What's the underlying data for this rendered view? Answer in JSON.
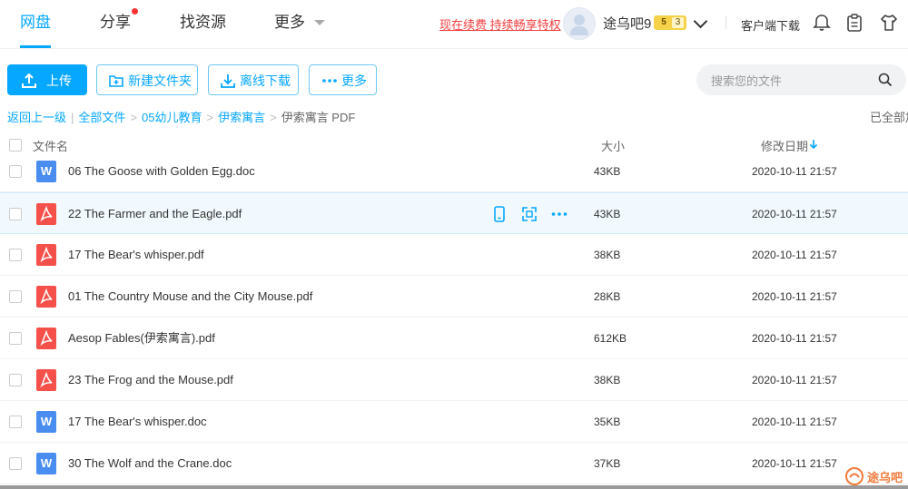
{
  "nav": {
    "tabs": [
      {
        "label": "网盘",
        "active": true
      },
      {
        "label": "分享"
      },
      {
        "label": "找资源"
      },
      {
        "label": "更多"
      }
    ],
    "promo": "现在续费 持续畅享特权",
    "username": "途乌吧9",
    "vip_level": "5",
    "vip_sub": "3",
    "client_download": "客户端下载",
    "icons": [
      "bell-icon",
      "clipboard-icon",
      "shirt-icon"
    ]
  },
  "toolbar": {
    "upload": "上传",
    "new_folder": "新建文件夹",
    "offline_download": "离线下载",
    "more": "更多"
  },
  "search": {
    "placeholder": "搜索您的文件"
  },
  "breadcrumb": {
    "back": "返回上一级",
    "items": [
      "全部文件",
      "05幼儿教育",
      "伊索寓言"
    ],
    "current": "伊索寓言 PDF"
  },
  "status": "已全部加",
  "table": {
    "headers": {
      "name": "文件名",
      "size": "大小",
      "date": "修改日期"
    },
    "rows": [
      {
        "name": "06 The Goose with Golden Egg.doc",
        "type": "doc",
        "size": "43KB",
        "date": "2020-10-11 21:57"
      },
      {
        "name": "22 The Farmer and the Eagle.pdf",
        "type": "pdf",
        "size": "43KB",
        "date": "2020-10-11 21:57",
        "hover": true
      },
      {
        "name": "17 The Bear's whisper.pdf",
        "type": "pdf",
        "size": "38KB",
        "date": "2020-10-11 21:57"
      },
      {
        "name": "01 The Country Mouse and the City Mouse.pdf",
        "type": "pdf",
        "size": "28KB",
        "date": "2020-10-11 21:57"
      },
      {
        "name": "Aesop Fables(伊索寓言).pdf",
        "type": "pdf",
        "size": "612KB",
        "date": "2020-10-11 21:57"
      },
      {
        "name": "23 The Frog and the Mouse.pdf",
        "type": "pdf",
        "size": "38KB",
        "date": "2020-10-11 21:57"
      },
      {
        "name": "17 The Bear's whisper.doc",
        "type": "doc",
        "size": "35KB",
        "date": "2020-10-11 21:57"
      },
      {
        "name": "30 The Wolf and the Crane.doc",
        "type": "doc",
        "size": "37KB",
        "date": "2020-10-11 21:57"
      }
    ],
    "row_actions": [
      "phone-icon",
      "share-icon",
      "more-dots-icon"
    ]
  },
  "watermark": "途乌吧",
  "colors": {
    "accent": "#06a7ff",
    "promo": "#f23d3d",
    "pdf": "#f5504a",
    "doc": "#4a8df0"
  }
}
